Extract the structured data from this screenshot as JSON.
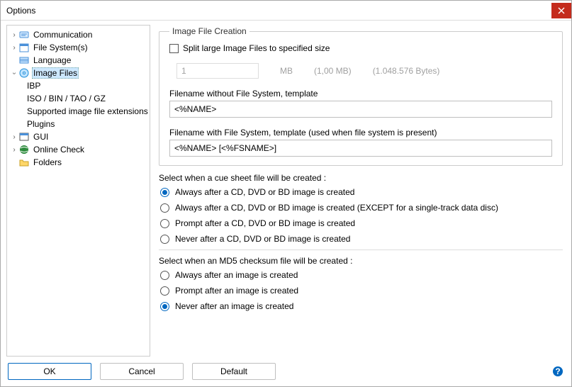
{
  "window": {
    "title": "Options"
  },
  "tree": {
    "items": [
      {
        "label": "Communication",
        "icon": "comm"
      },
      {
        "label": "File System(s)",
        "icon": "fs"
      },
      {
        "label": "Language",
        "icon": "lang"
      },
      {
        "label": "Image Files",
        "icon": "img"
      },
      {
        "label": "IBP"
      },
      {
        "label": "ISO / BIN / TAO / GZ"
      },
      {
        "label": "Supported image file extensions"
      },
      {
        "label": "Plugins"
      },
      {
        "label": "GUI",
        "icon": "gui"
      },
      {
        "label": "Online Check",
        "icon": "online"
      },
      {
        "label": "Folders",
        "icon": "folder"
      }
    ]
  },
  "group": {
    "legend": "Image File Creation",
    "split_label": "Split large Image Files to specified size",
    "size_value": "1",
    "size_unit": "MB",
    "size_hint1": "(1,00 MB)",
    "size_hint2": "(1.048.576 Bytes)",
    "fn_nofs_label": "Filename without File System, template",
    "fn_nofs_value": "<%NAME>",
    "fn_fs_label": "Filename with File System, template (used when file system is present)",
    "fn_fs_value": "<%NAME> [<%FSNAME>]"
  },
  "cue": {
    "heading": "Select when a cue sheet file will be created :",
    "opt1": "Always after a CD, DVD or BD image is created",
    "opt2": "Always after a CD, DVD or BD image is created (EXCEPT for a single-track data disc)",
    "opt3": "Prompt after a CD, DVD or BD image is created",
    "opt4": "Never after a CD, DVD or BD image is created"
  },
  "md5": {
    "heading": "Select when an MD5 checksum file will be created :",
    "opt1": "Always after an image is created",
    "opt2": "Prompt after an image is created",
    "opt3": "Never after an image is created"
  },
  "footer": {
    "ok": "OK",
    "cancel": "Cancel",
    "default": "Default"
  }
}
